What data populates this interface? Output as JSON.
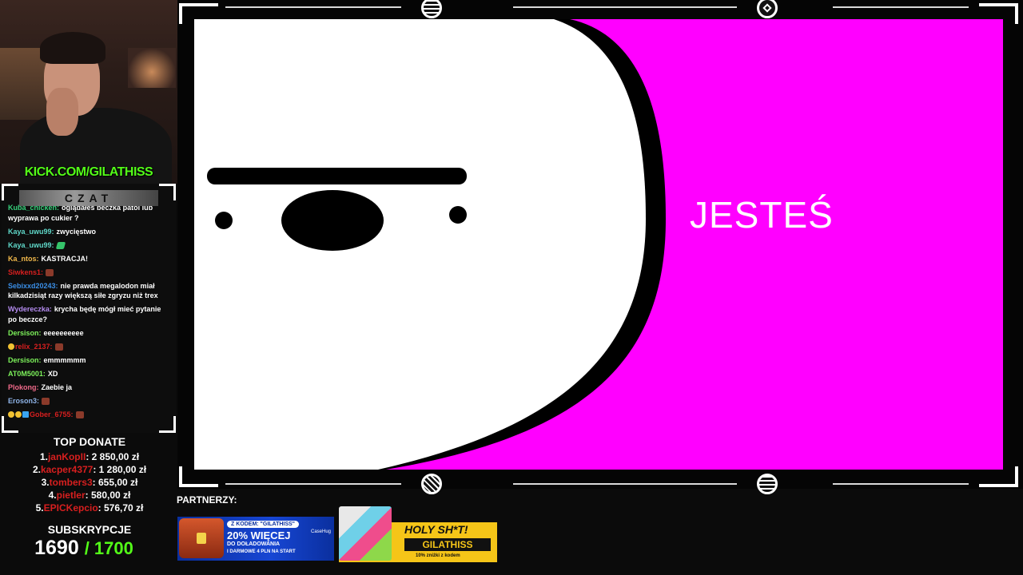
{
  "webcam": {
    "channel_url": "KICK.COM/GILATHISS"
  },
  "chat": {
    "header": "CZAT",
    "messages": [
      {
        "user": "Kuba_chicken:",
        "color": "#35d07a",
        "text": "oglądałeś beczka patol lub wyprawa po cukier ?",
        "badges": [],
        "emote": ""
      },
      {
        "user": "Kaya_uwu99:",
        "color": "#5fd7c8",
        "text": "zwycięstwo",
        "badges": [],
        "emote": ""
      },
      {
        "user": "Kaya_uwu99:",
        "color": "#5fd7c8",
        "text": "",
        "badges": [],
        "emote": "green"
      },
      {
        "user": "Ka_ntos:",
        "color": "#f2b94b",
        "text": "KASTRACJA!",
        "badges": [],
        "emote": ""
      },
      {
        "user": "Siwkens1:",
        "color": "#d81f1f",
        "text": "",
        "badges": [],
        "emote": "brown"
      },
      {
        "user": "Sebixxd20243:",
        "color": "#3a8ee6",
        "text": "nie prawda megalodon miał kilkadzisiąt razy większą siłe zgryzu niż trex",
        "badges": [],
        "emote": ""
      },
      {
        "user": "Wydereczka:",
        "color": "#b58cf0",
        "text": "krycha będę mógł mieć pytanie po beczce?",
        "badges": [],
        "emote": ""
      },
      {
        "user": "Dersison:",
        "color": "#7cf05a",
        "text": "eeeeeeeeee",
        "badges": [],
        "emote": ""
      },
      {
        "user": "relix_2137:",
        "color": "#d81f1f",
        "text": "",
        "badges": [
          "gold"
        ],
        "emote": "brown"
      },
      {
        "user": "Dersison:",
        "color": "#7cf05a",
        "text": "emmmmmm",
        "badges": [],
        "emote": ""
      },
      {
        "user": "AT0M5001:",
        "color": "#7cf05a",
        "text": "XD",
        "badges": [],
        "emote": ""
      },
      {
        "user": "Plokong:",
        "color": "#f06a8a",
        "text": "Zaebie ja",
        "badges": [],
        "emote": ""
      },
      {
        "user": "Eroson3:",
        "color": "#8fb4e8",
        "text": "",
        "badges": [],
        "emote": "brown"
      },
      {
        "user": "Gober_6755:",
        "color": "#d81f1f",
        "text": "",
        "badges": [
          "gold",
          "gold",
          "blue"
        ],
        "emote": "brown"
      }
    ]
  },
  "top_donate": {
    "title": "TOP DONATE",
    "donors": [
      {
        "rank": "1.",
        "name": "janKopII",
        "amount": ": 2 850,00 zł"
      },
      {
        "rank": "2.",
        "name": "kacper4377",
        "amount": ": 1 280,00 zł"
      },
      {
        "rank": "3.",
        "name": "tombers3",
        "amount": ": 655,00 zł"
      },
      {
        "rank": "4.",
        "name": "pietler",
        "amount": ": 580,00 zł"
      },
      {
        "rank": "5.",
        "name": "EPICKepcio",
        "amount": ": 576,70 zł"
      }
    ]
  },
  "subs": {
    "title": "SUBSKRYPCJE",
    "current": "1690",
    "goal": "/ 1700"
  },
  "video": {
    "text": "JESTEŚ",
    "background": "#ff00ff"
  },
  "partners": {
    "label": "PARTNERZY:",
    "case_banner": {
      "code_label": "Z KODEM: \"GILATHISS\"",
      "headline": "20% WIĘCEJ",
      "line2": "DO DOŁADOWANIA",
      "line3": "I DARMOWE 4 PLN NA START",
      "brand": "CaseHug"
    },
    "holy_banner": {
      "title": "HOLY SH*T!",
      "code": "GILATHISS",
      "note": "10% zniżki z kodem"
    }
  },
  "colors": {
    "kick_green": "#53fc18",
    "donor_red": "#d81f1f",
    "magenta": "#ff00ff"
  }
}
